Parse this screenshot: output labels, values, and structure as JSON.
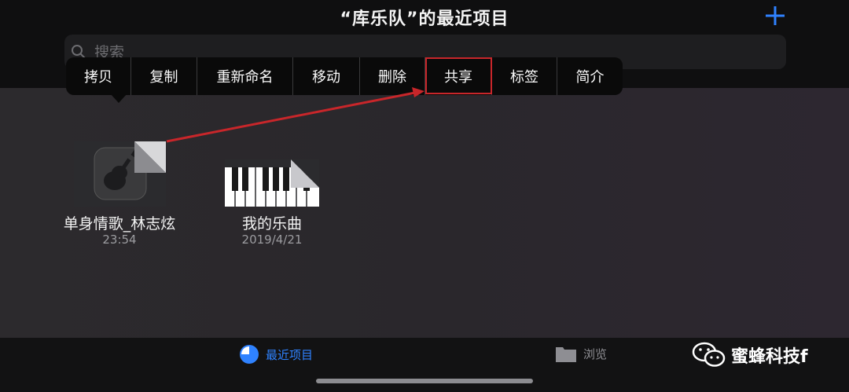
{
  "header": {
    "title": "“库乐队”的最近项目",
    "add_icon": "plus-icon"
  },
  "search": {
    "placeholder": "搜索"
  },
  "context_menu": {
    "items": [
      "拷贝",
      "复制",
      "重新命名",
      "移动",
      "删除",
      "共享",
      "标签",
      "简介"
    ],
    "highlighted": "共享"
  },
  "files": [
    {
      "name": "单身情歌_林志炫",
      "date": "23:54",
      "icon": "guitar-icon"
    },
    {
      "name": "我的乐曲",
      "date": "2019/4/21",
      "icon": "keyboard-icon"
    }
  ],
  "tabbar": {
    "recent_label": "最近项目",
    "browse_label": "浏览"
  },
  "watermark": {
    "text": "蜜蜂科技f"
  },
  "colors": {
    "accent": "#2f82ff",
    "highlight": "#c8262a"
  }
}
